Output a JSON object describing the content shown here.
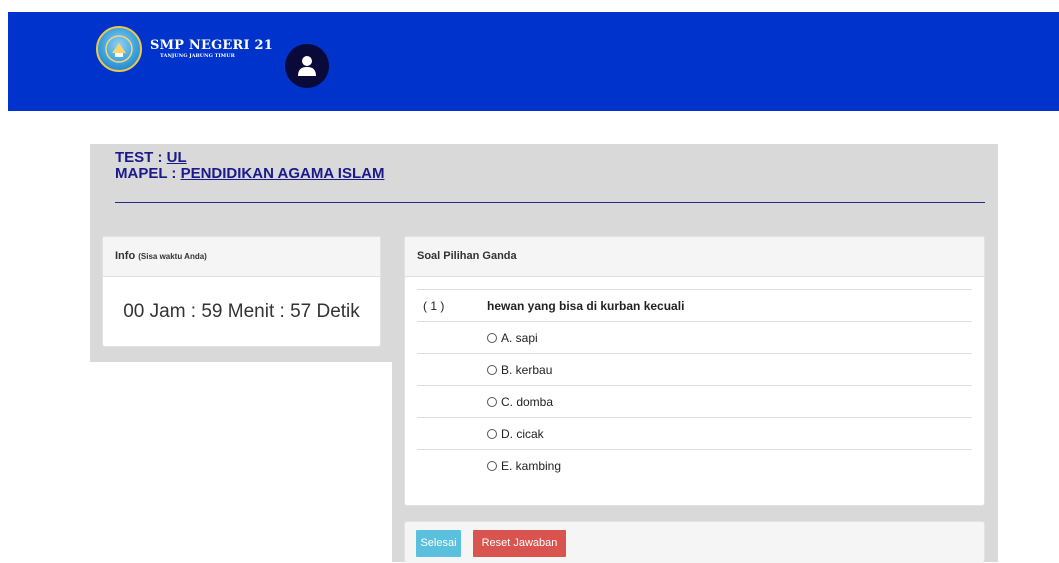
{
  "header": {
    "school_name": "SMP NEGERI 21",
    "school_sub": "TANJUNG JABUNG TIMUR",
    "logo_icon": "school-emblem-icon",
    "avatar_icon": "user-icon"
  },
  "test": {
    "test_label": "TEST : ",
    "test_value": "UL",
    "mapel_label": "MAPEL : ",
    "mapel_value": "PENDIDIKAN AGAMA ISLAM"
  },
  "info": {
    "title": "Info ",
    "subtitle": "(Sisa waktu Anda)",
    "timer": "00 Jam : 59 Menit : 57 Detik"
  },
  "soal": {
    "title": "Soal Pilihan Ganda",
    "number": "( 1 )",
    "question": "hewan yang bisa di kurban kecuali",
    "options": [
      "A. sapi",
      "B. kerbau",
      "C. domba",
      "D. cicak",
      "E. kambing"
    ]
  },
  "actions": {
    "finish_label": "Selesai",
    "reset_label": "Reset Jawaban"
  },
  "colors": {
    "header_bg": "#0033cc",
    "finish_btn": "#5bc0de",
    "reset_btn": "#d9534f"
  }
}
